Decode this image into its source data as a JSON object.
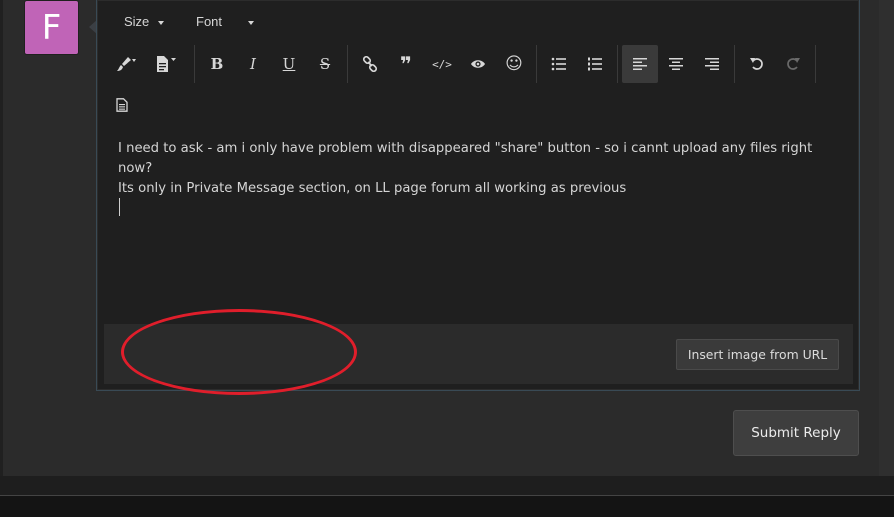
{
  "avatar": {
    "letter": "F",
    "color": "#c064b7"
  },
  "toolbar": {
    "size_label": "Size",
    "font_label": "Font",
    "buttons": [
      {
        "name": "text-color",
        "icon": "paintbrush-icon"
      },
      {
        "name": "paragraph-format",
        "icon": "document-icon"
      },
      {
        "name": "bold",
        "icon": "bold-icon",
        "glyph": "B"
      },
      {
        "name": "italic",
        "icon": "italic-icon",
        "glyph": "I"
      },
      {
        "name": "underline",
        "icon": "underline-icon",
        "glyph": "U"
      },
      {
        "name": "strikethrough",
        "icon": "strikethrough-icon",
        "glyph": "S"
      },
      {
        "name": "link",
        "icon": "link-icon"
      },
      {
        "name": "quote",
        "icon": "quote-icon",
        "glyph": "❞"
      },
      {
        "name": "code",
        "icon": "code-icon",
        "glyph": "</>"
      },
      {
        "name": "spoiler",
        "icon": "eye-icon"
      },
      {
        "name": "smilies",
        "icon": "smiley-icon",
        "glyph": "☺"
      },
      {
        "name": "unordered-list",
        "icon": "bullet-list-icon"
      },
      {
        "name": "ordered-list",
        "icon": "numbered-list-icon"
      },
      {
        "name": "align-left",
        "icon": "align-left-icon"
      },
      {
        "name": "align-center",
        "icon": "align-center-icon"
      },
      {
        "name": "align-right",
        "icon": "align-right-icon"
      },
      {
        "name": "undo",
        "icon": "undo-icon"
      },
      {
        "name": "redo",
        "icon": "redo-icon"
      },
      {
        "name": "source",
        "icon": "source-document-icon"
      }
    ]
  },
  "message": {
    "line1": "I need to ask - am i only have problem with disappeared \"share\" button - so i cannt upload any files right now?",
    "line2": "Its only in Private Message section, on LL page forum all working as previous"
  },
  "footer": {
    "insert_image_label": "Insert image from URL"
  },
  "submit_label": "Submit Reply",
  "annotation": {
    "color": "#e01e2b"
  }
}
